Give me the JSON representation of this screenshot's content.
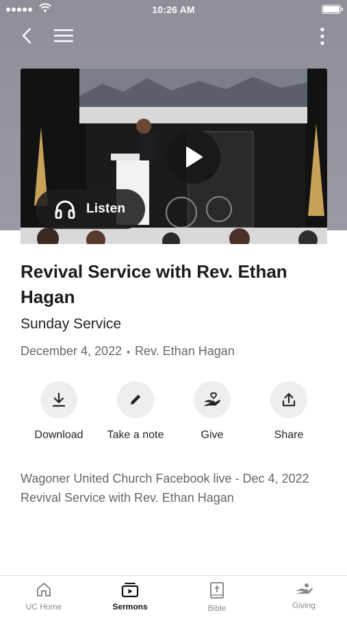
{
  "status_bar": {
    "time": "10:26 AM"
  },
  "colors": {
    "accent": "#1b1b1b",
    "inactive_tab": "#8a8a8a",
    "hero_bg": "#9a9aa4"
  },
  "video": {
    "listen_label": "Listen",
    "icons": [
      "play-icon",
      "headphones-icon"
    ]
  },
  "sermon": {
    "title": "Revival Service with Rev. Ethan Hagan",
    "series": "Sunday Service",
    "date": "December 4, 2022",
    "separator": "•",
    "speaker": "Rev. Ethan Hagan",
    "description": "Wagoner United Church Facebook live -  Dec 4, 2022 Revival Service with Rev. Ethan Hagan"
  },
  "actions": [
    {
      "label": "Download",
      "icon": "download-icon"
    },
    {
      "label": "Take a note",
      "icon": "pencil-icon"
    },
    {
      "label": "Give",
      "icon": "heart-hand-icon"
    },
    {
      "label": "Share",
      "icon": "share-icon"
    }
  ],
  "tabs": [
    {
      "label": "UC Home",
      "icon": "home-icon",
      "active": false
    },
    {
      "label": "Sermons",
      "icon": "sermons-icon",
      "active": true
    },
    {
      "label": "Bible",
      "icon": "bible-icon",
      "active": false
    },
    {
      "label": "Giving",
      "icon": "giving-icon",
      "active": false
    }
  ]
}
